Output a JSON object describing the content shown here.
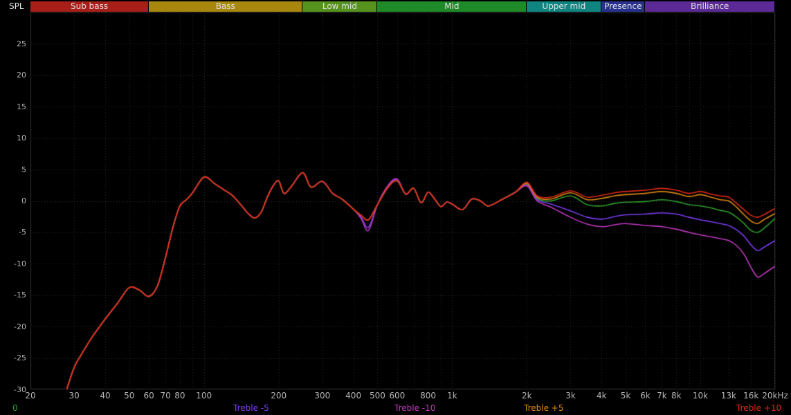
{
  "y_axis": {
    "title": "SPL",
    "max": 30,
    "min": -30,
    "ticks": [
      25,
      20,
      15,
      10,
      5,
      0,
      -5,
      -10,
      -15,
      -20,
      -25,
      -30
    ]
  },
  "header": {
    "bands": [
      {
        "label": "Sub bass",
        "from": 20,
        "to": 60,
        "color": "#a81f1a"
      },
      {
        "label": "Bass",
        "from": 60,
        "to": 250,
        "color": "#a8870f"
      },
      {
        "label": "Low mid",
        "from": 250,
        "to": 500,
        "color": "#55921e"
      },
      {
        "label": "Mid",
        "from": 500,
        "to": 2000,
        "color": "#1e8a28"
      },
      {
        "label": "Upper mid",
        "from": 2000,
        "to": 4000,
        "color": "#0f8480"
      },
      {
        "label": "Presence",
        "from": 4000,
        "to": 6000,
        "color": "#28318e"
      },
      {
        "label": "Brilliance",
        "from": 6000,
        "to": 20000,
        "color": "#5c2a96"
      }
    ]
  },
  "x_axis": {
    "ticks": [
      {
        "label": "20",
        "f": 20
      },
      {
        "label": "30",
        "f": 30
      },
      {
        "label": "40",
        "f": 40
      },
      {
        "label": "50",
        "f": 50
      },
      {
        "label": "60",
        "f": 60
      },
      {
        "label": "70",
        "f": 70
      },
      {
        "label": "80",
        "f": 80
      },
      {
        "label": "100",
        "f": 100
      },
      {
        "label": "200",
        "f": 200
      },
      {
        "label": "300",
        "f": 300
      },
      {
        "label": "400",
        "f": 400
      },
      {
        "label": "500",
        "f": 500
      },
      {
        "label": "600",
        "f": 600
      },
      {
        "label": "800",
        "f": 800
      },
      {
        "label": "1k",
        "f": 1000
      },
      {
        "label": "2k",
        "f": 2000
      },
      {
        "label": "3k",
        "f": 3000
      },
      {
        "label": "4k",
        "f": 4000
      },
      {
        "label": "5k",
        "f": 5000
      },
      {
        "label": "6k",
        "f": 6000
      },
      {
        "label": "7k",
        "f": 7000
      },
      {
        "label": "8k",
        "f": 8000
      },
      {
        "label": "10k",
        "f": 10000
      },
      {
        "label": "13k",
        "f": 13000
      },
      {
        "label": "16k",
        "f": 16000
      },
      {
        "label": "20kHz",
        "f": 20000
      }
    ]
  },
  "chart_data": {
    "type": "line",
    "x_scale": "log",
    "xlim": [
      20,
      20000
    ],
    "ylim": [
      -30,
      30
    ],
    "ylabel": "SPL",
    "grid": true,
    "legend_position": "bottom",
    "freqs": [
      28,
      30,
      32,
      35,
      38,
      40,
      45,
      50,
      55,
      60,
      65,
      70,
      75,
      80,
      85,
      90,
      100,
      110,
      120,
      130,
      140,
      150,
      160,
      170,
      180,
      190,
      200,
      210,
      225,
      250,
      270,
      300,
      330,
      360,
      400,
      430,
      460,
      500,
      550,
      600,
      650,
      700,
      750,
      800,
      850,
      900,
      950,
      1000,
      1100,
      1200,
      1300,
      1400,
      1600,
      1800,
      2000,
      2200,
      2500,
      3000,
      3500,
      4000,
      4500,
      5000,
      6000,
      7000,
      8000,
      9000,
      10000,
      11000,
      12000,
      13000,
      14000,
      15000,
      16000,
      17000,
      18000,
      20000
    ],
    "series": [
      {
        "name": "0",
        "color": "#30a030",
        "values": [
          -30,
          -26.5,
          -24.5,
          -22,
          -20,
          -18.8,
          -16.2,
          -13.8,
          -14.2,
          -15.2,
          -13.5,
          -9,
          -4.2,
          -0.8,
          0.2,
          1.3,
          3.8,
          2.8,
          1.8,
          0.9,
          -0.5,
          -1.9,
          -2.7,
          -1.8,
          0.6,
          2.4,
          3.2,
          1.2,
          2.3,
          4.5,
          2.2,
          3.1,
          1.2,
          0.3,
          -1.3,
          -2.3,
          -3,
          -0.6,
          2.1,
          3.2,
          1.1,
          2,
          -0.3,
          1.4,
          0.3,
          -0.9,
          -0.2,
          -0.5,
          -1.4,
          0.3,
          0,
          -0.8,
          0.3,
          1.4,
          2.6,
          0.4,
          0,
          0.8,
          -0.6,
          -0.8,
          -0.4,
          -0.2,
          -0.1,
          0.2,
          -0.1,
          -0.6,
          -0.8,
          -1.1,
          -1.5,
          -1.8,
          -2.6,
          -3.6,
          -4.7,
          -5,
          -4.4,
          -2.8
        ]
      },
      {
        "name": "Treble -5",
        "color": "#7a3cf0",
        "values": [
          -30,
          -26.5,
          -24.5,
          -22,
          -20,
          -18.8,
          -16.2,
          -13.8,
          -14.2,
          -15.2,
          -13.5,
          -9,
          -4.2,
          -0.8,
          0.2,
          1.3,
          3.8,
          2.8,
          1.8,
          0.9,
          -0.5,
          -1.9,
          -2.7,
          -1.8,
          0.6,
          2.4,
          3.2,
          1.2,
          2.3,
          4.5,
          2.2,
          3.1,
          1.2,
          0.3,
          -1.3,
          -2.6,
          -4.2,
          -0.6,
          2.3,
          3.4,
          1.1,
          2,
          -0.3,
          1.4,
          0.3,
          -0.9,
          -0.2,
          -0.5,
          -1.4,
          0.3,
          0,
          -0.8,
          0.3,
          1.4,
          2.5,
          0.2,
          -0.5,
          -1.6,
          -2.6,
          -2.9,
          -2.5,
          -2.2,
          -2.1,
          -1.9,
          -2.1,
          -2.6,
          -3,
          -3.3,
          -3.6,
          -3.9,
          -4.6,
          -5.6,
          -7,
          -7.9,
          -7.4,
          -6.3
        ]
      },
      {
        "name": "Treble -10",
        "color": "#c038c0",
        "values": [
          -30,
          -26.5,
          -24.5,
          -22,
          -20,
          -18.8,
          -16.2,
          -13.8,
          -14.2,
          -15.2,
          -13.5,
          -9,
          -4.2,
          -0.8,
          0.2,
          1.3,
          3.8,
          2.8,
          1.8,
          0.9,
          -0.5,
          -1.9,
          -2.7,
          -1.8,
          0.6,
          2.4,
          3.2,
          1.2,
          2.3,
          4.5,
          2.2,
          3.1,
          1.2,
          0.3,
          -1.3,
          -2.8,
          -4.7,
          -0.6,
          2.4,
          3.5,
          1.1,
          2,
          -0.3,
          1.4,
          0.3,
          -0.9,
          -0.2,
          -0.5,
          -1.4,
          0.3,
          0,
          -0.8,
          0.3,
          1.4,
          2.4,
          0,
          -1,
          -2.6,
          -3.7,
          -4.1,
          -3.8,
          -3.6,
          -3.9,
          -4.1,
          -4.5,
          -5,
          -5.4,
          -5.7,
          -6,
          -6.3,
          -7.1,
          -8.5,
          -10.6,
          -12.1,
          -11.6,
          -10.4
        ]
      },
      {
        "name": "Treble +5",
        "color": "#e08a10",
        "values": [
          -30,
          -26.5,
          -24.5,
          -22,
          -20,
          -18.8,
          -16.2,
          -13.8,
          -14.2,
          -15.2,
          -13.5,
          -9,
          -4.2,
          -0.8,
          0.2,
          1.3,
          3.8,
          2.8,
          1.8,
          0.9,
          -0.5,
          -1.9,
          -2.7,
          -1.8,
          0.6,
          2.4,
          3.2,
          1.2,
          2.3,
          4.5,
          2.2,
          3.1,
          1.2,
          0.3,
          -1.3,
          -2.3,
          -3,
          -0.6,
          2.1,
          3.2,
          1.1,
          2,
          -0.3,
          1.4,
          0.3,
          -0.9,
          -0.2,
          -0.5,
          -1.4,
          0.3,
          0,
          -0.8,
          0.3,
          1.4,
          2.8,
          0.6,
          0.3,
          1.3,
          0.2,
          0.4,
          0.8,
          1,
          1.2,
          1.5,
          1.2,
          0.7,
          1,
          0.6,
          0.2,
          0,
          -1,
          -2.2,
          -3.2,
          -3.6,
          -3,
          -2
        ]
      },
      {
        "name": "Treble +10",
        "color": "#e02817",
        "values": [
          -30,
          -26.5,
          -24.5,
          -22,
          -20,
          -18.8,
          -16.2,
          -13.8,
          -14.2,
          -15.2,
          -13.5,
          -9,
          -4.2,
          -0.8,
          0.2,
          1.3,
          3.8,
          2.8,
          1.8,
          0.9,
          -0.5,
          -1.9,
          -2.7,
          -1.8,
          0.6,
          2.4,
          3.2,
          1.2,
          2.3,
          4.5,
          2.2,
          3.1,
          1.2,
          0.3,
          -1.3,
          -2.3,
          -3,
          -0.6,
          2.1,
          3.2,
          1.1,
          2,
          -0.3,
          1.4,
          0.3,
          -0.9,
          -0.2,
          -0.5,
          -1.4,
          0.3,
          0,
          -0.8,
          0.3,
          1.4,
          3,
          0.8,
          0.6,
          1.6,
          0.6,
          0.9,
          1.3,
          1.5,
          1.7,
          2,
          1.7,
          1.2,
          1.5,
          1.1,
          0.8,
          0.6,
          -0.4,
          -1.4,
          -2.3,
          -2.6,
          -2.2,
          -1.2
        ]
      }
    ]
  }
}
